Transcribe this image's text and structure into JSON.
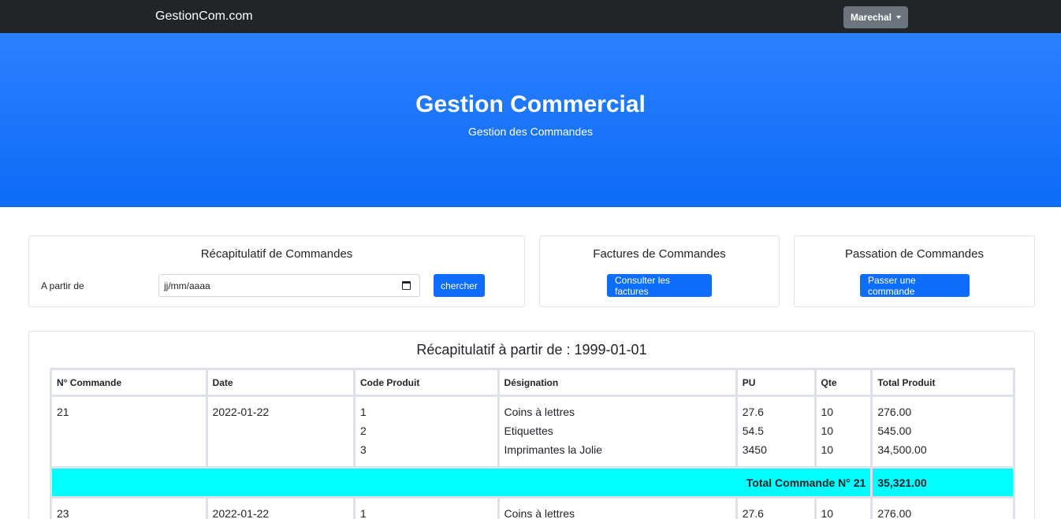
{
  "navbar": {
    "brand": "GestionCom.com",
    "user": "Marechal"
  },
  "hero": {
    "title": "Gestion Commercial",
    "subtitle": "Gestion des Commandes"
  },
  "recap_card": {
    "title": "Récapitulatif de Commandes",
    "from_label": "A partir de",
    "date_placeholder": "jj/mm/aaaa",
    "search_button": "chercher"
  },
  "invoices_card": {
    "title": "Factures de Commandes",
    "button": "Consulter les factures"
  },
  "order_card": {
    "title": "Passation de Commandes",
    "button": "Passer une commande"
  },
  "recap": {
    "title": "Récapitulatif à partir de : 1999-01-01",
    "columns": [
      "N° Commande",
      "Date",
      "Code Produit",
      "Désignation",
      "PU",
      "Qte",
      "Total Produit"
    ],
    "orders": [
      {
        "number": "21",
        "date": "2022-01-22",
        "items": [
          {
            "code": "1",
            "designation": "Coins à lettres",
            "pu": "27.6",
            "qte": "10",
            "total": "276.00"
          },
          {
            "code": "2",
            "designation": "Etiquettes",
            "pu": "54.5",
            "qte": "10",
            "total": "545.00"
          },
          {
            "code": "3",
            "designation": "Imprimantes la Jolie",
            "pu": "3450",
            "qte": "10",
            "total": "34,500.00"
          }
        ],
        "total_label": "Total Commande N° 21",
        "total": "35,321.00"
      },
      {
        "number": "23",
        "date": "2022-01-22",
        "items": [
          {
            "code": "1",
            "designation": "Coins à lettres",
            "pu": "27.6",
            "qte": "10",
            "total": "276.00"
          }
        ]
      }
    ]
  }
}
